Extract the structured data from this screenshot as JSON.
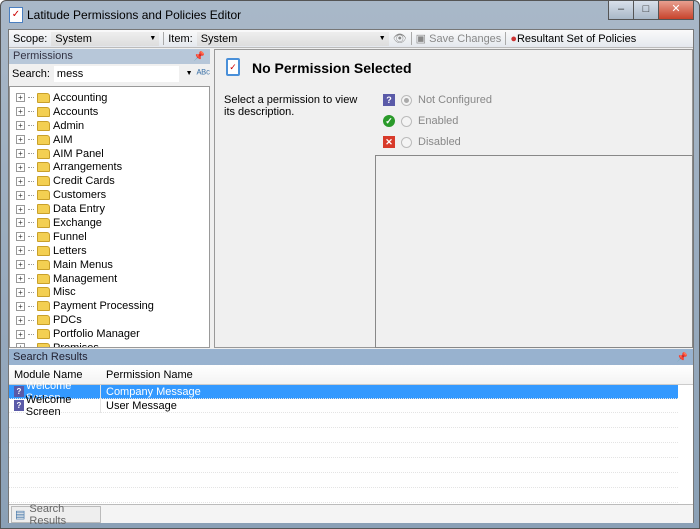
{
  "window": {
    "title": "Latitude Permissions and Policies Editor",
    "minimize": "–",
    "maximize": "□",
    "close": "✕"
  },
  "toolbar": {
    "scope_label": "Scope:",
    "scope_value": "System",
    "item_label": "Item:",
    "item_value": "System",
    "save": "Save Changes",
    "rsop": "Resultant Set of Policies"
  },
  "permissions": {
    "header": "Permissions",
    "search_label": "Search:",
    "search_value": "mess",
    "tree": [
      "Accounting",
      "Accounts",
      "Admin",
      "AIM",
      "AIM Panel",
      "Arrangements",
      "Credit Cards",
      "Customers",
      "Data Entry",
      "Exchange",
      "Funnel",
      "Letters",
      "Main Menus",
      "Management",
      "Misc",
      "Payment Processing",
      "PDCs",
      "Portfolio Manager",
      "Promises"
    ]
  },
  "detail": {
    "title": "No Permission Selected",
    "description": "Select a permission to view its description.",
    "options": [
      {
        "label": "Not Configured",
        "selected": true
      },
      {
        "label": "Enabled",
        "selected": false
      },
      {
        "label": "Disabled",
        "selected": false
      }
    ]
  },
  "search_results": {
    "header": "Search Results",
    "columns": [
      "Module Name",
      "Permission Name"
    ],
    "rows": [
      {
        "module": "Welcome Screen",
        "permission": "Company Message",
        "selected": true
      },
      {
        "module": "Welcome Screen",
        "permission": "User Message",
        "selected": false
      }
    ],
    "tab": "Search Results"
  }
}
